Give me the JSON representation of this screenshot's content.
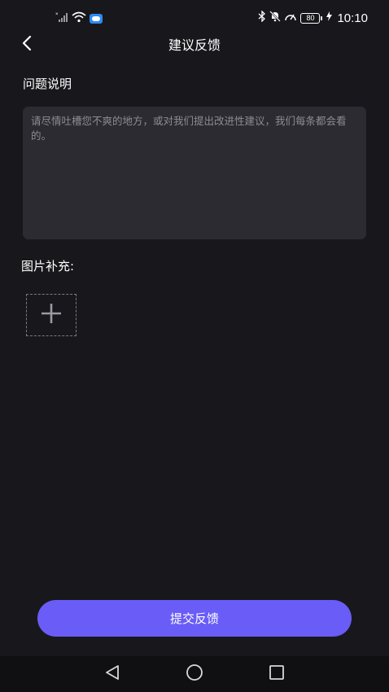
{
  "status_bar": {
    "time": "10:10",
    "battery": "80",
    "icons": [
      "signal-icon",
      "wifi-icon",
      "cloud-icon",
      "bluetooth-icon",
      "mute-bell-icon",
      "speed-icon",
      "battery-icon",
      "charging-icon"
    ]
  },
  "header": {
    "title": "建议反馈",
    "back_icon": "chevron-left-icon"
  },
  "problem": {
    "label": "问题说明",
    "value": "",
    "placeholder": "请尽情吐槽您不爽的地方，或对我们提出改进性建议，我们每条都会看的。"
  },
  "images": {
    "label": "图片补充:",
    "add_icon": "plus-icon"
  },
  "submit": {
    "label": "提交反馈"
  },
  "colors": {
    "background": "#18181c",
    "input_background": "#2b2b31",
    "accent": "#6a5cf6",
    "placeholder": "#8c8c92"
  },
  "system_nav": {
    "icons": [
      "triangle-back-icon",
      "circle-home-icon",
      "square-recent-icon"
    ]
  }
}
